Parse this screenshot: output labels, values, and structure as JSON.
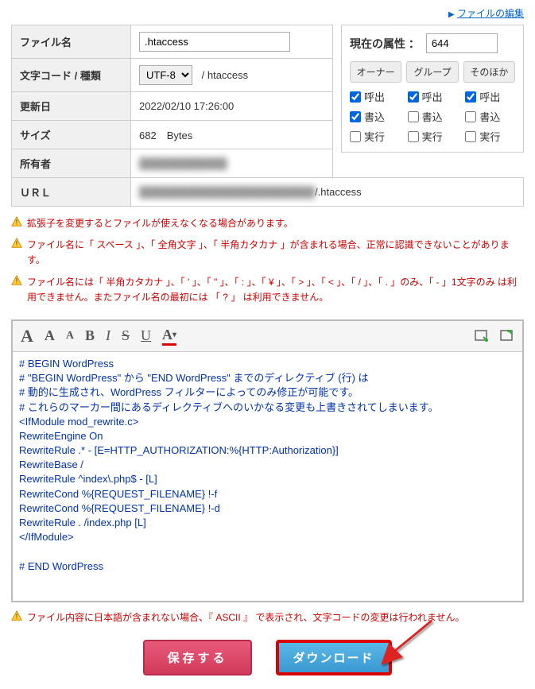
{
  "topLink": "ファイルの編集",
  "labels": {
    "filename": "ファイル名",
    "charset": "文字コード / 種類",
    "updated": "更新日",
    "size": "サイズ",
    "owner": "所有者",
    "url": "ＵＲＬ"
  },
  "values": {
    "filename": ".htaccess",
    "charset": "UTF-8",
    "filetype": "/ htaccess",
    "updated": "2022/02/10 17:26:00",
    "size": "682　Bytes",
    "owner": "",
    "url_suffix": "/.htaccess"
  },
  "attr": {
    "title": "現在の属性 ：",
    "value": "644",
    "headers": [
      "オーナー",
      "グループ",
      "そのほか"
    ],
    "rows": [
      "呼出",
      "書込",
      "実行"
    ],
    "checked": [
      [
        true,
        true,
        true
      ],
      [
        true,
        false,
        false
      ],
      [
        false,
        false,
        false
      ]
    ]
  },
  "warnings": [
    "拡張子を変更するとファイルが使えなくなる場合があります。",
    "ファイル名に「 スペース 」、「 全角文字 」、「 半角カタカナ 」が含まれる場合、正常に認識できないことがあります。",
    "ファイル名には「 半角カタカナ 」、「 ' 」、「 \" 」、「 : 」、「 ¥ 」、「 > 」、「 < 」、「 / 」、「 . 」のみ、「 - 」1文字のみ は利用できません。またファイル名の最初には 「 ? 」 は利用できません。"
  ],
  "editorContent": "# BEGIN WordPress\n# \"BEGIN WordPress\" から \"END WordPress\" までのディレクティブ (行) は\n# 動的に生成され、WordPress フィルターによってのみ修正が可能です。\n# これらのマーカー間にあるディレクティブへのいかなる変更も上書きされてしまいます。\n<IfModule mod_rewrite.c>\nRewriteEngine On\nRewriteRule .* - [E=HTTP_AUTHORIZATION:%{HTTP:Authorization}]\nRewriteBase /\nRewriteRule ^index\\.php$ - [L]\nRewriteCond %{REQUEST_FILENAME} !-f\nRewriteCond %{REQUEST_FILENAME} !-d\nRewriteRule . /index.php [L]\n</IfModule>\n\n# END WordPress",
  "bottomWarning": "ファイル内容に日本語が含まれない場合、『 ASCII 』 で表示され、文字コードの変更は行われません。",
  "buttons": {
    "save": "保存する",
    "download": "ダウンロード"
  }
}
